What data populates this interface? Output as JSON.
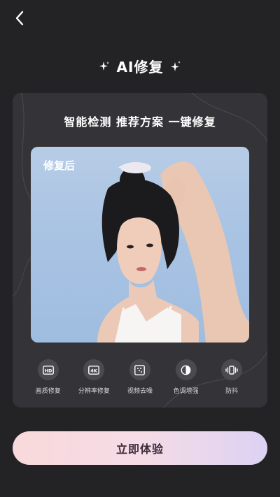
{
  "header": {
    "title": "AI修复"
  },
  "card": {
    "subtitle": "智能检测  推荐方案  一键修复",
    "photo_label": "修复后"
  },
  "tools": [
    {
      "label": "画质修复",
      "icon": "hd-icon"
    },
    {
      "label": "分辨率修复",
      "icon": "4k-icon"
    },
    {
      "label": "视频去噪",
      "icon": "denoise-icon"
    },
    {
      "label": "色调增强",
      "icon": "color-tone-icon"
    },
    {
      "label": "防抖",
      "icon": "stabilize-icon"
    }
  ],
  "cta": {
    "label": "立即体验"
  },
  "colors": {
    "background": "#232325",
    "card": "#343438",
    "cta_gradient_start": "#f9d9db",
    "cta_gradient_end": "#dcd2f3",
    "cta_text": "#3c2a3a"
  }
}
